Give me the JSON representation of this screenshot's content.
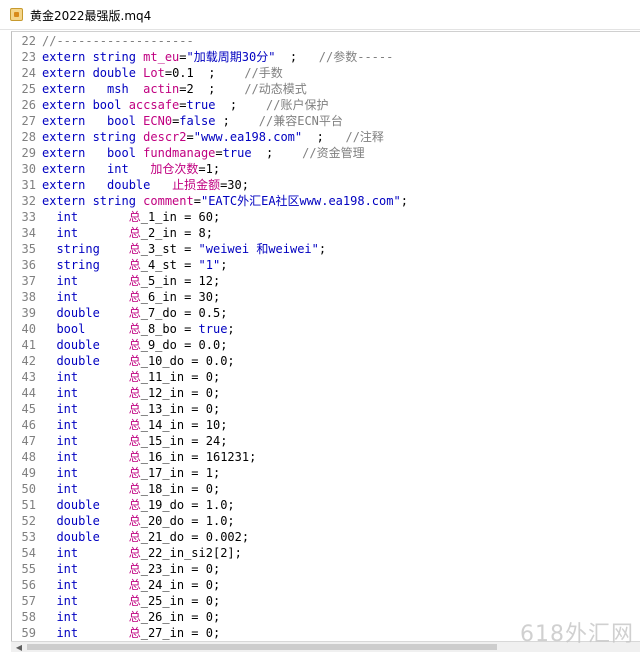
{
  "window": {
    "title": "黄金2022最强版.mq4",
    "icon": "file-mq4-icon"
  },
  "colors": {
    "keyword": "#0000c0",
    "identifier": "#c00080",
    "comment": "#808080",
    "line_number": "#808080"
  },
  "code_lines": [
    {
      "n": "22",
      "tokens": [
        {
          "t": "//-------------------",
          "c": "cmt"
        }
      ]
    },
    {
      "n": "23",
      "tokens": [
        {
          "t": "extern ",
          "c": "kw"
        },
        {
          "t": "string ",
          "c": "tp"
        },
        {
          "t": "mt_eu",
          "c": "id"
        },
        {
          "t": "=",
          "c": "op"
        },
        {
          "t": "\"加载周期30分\"",
          "c": "str"
        },
        {
          "t": "  ;   ",
          "c": "op"
        },
        {
          "t": "//参数-----",
          "c": "cmt"
        }
      ]
    },
    {
      "n": "24",
      "tokens": [
        {
          "t": "extern ",
          "c": "kw"
        },
        {
          "t": "double ",
          "c": "tp"
        },
        {
          "t": "Lot",
          "c": "id"
        },
        {
          "t": "=0.1  ;    ",
          "c": "op"
        },
        {
          "t": "//手数",
          "c": "cmt"
        }
      ]
    },
    {
      "n": "25",
      "tokens": [
        {
          "t": "extern   ",
          "c": "kw"
        },
        {
          "t": "msh  ",
          "c": "tp"
        },
        {
          "t": "actin",
          "c": "id"
        },
        {
          "t": "=2  ;    ",
          "c": "op"
        },
        {
          "t": "//动态模式",
          "c": "cmt"
        }
      ]
    },
    {
      "n": "26",
      "tokens": [
        {
          "t": "extern ",
          "c": "kw"
        },
        {
          "t": "bool ",
          "c": "tp"
        },
        {
          "t": "accsafe",
          "c": "id"
        },
        {
          "t": "=",
          "c": "op"
        },
        {
          "t": "true",
          "c": "kw"
        },
        {
          "t": "  ;    ",
          "c": "op"
        },
        {
          "t": "//账户保护",
          "c": "cmt"
        }
      ]
    },
    {
      "n": "27",
      "tokens": [
        {
          "t": "extern   ",
          "c": "kw"
        },
        {
          "t": "bool ",
          "c": "tp"
        },
        {
          "t": "ECN0",
          "c": "id"
        },
        {
          "t": "=",
          "c": "op"
        },
        {
          "t": "false",
          "c": "kw"
        },
        {
          "t": " ;    ",
          "c": "op"
        },
        {
          "t": "//兼容ECN平台",
          "c": "cmt"
        }
      ]
    },
    {
      "n": "28",
      "tokens": [
        {
          "t": "extern ",
          "c": "kw"
        },
        {
          "t": "string ",
          "c": "tp"
        },
        {
          "t": "descr2",
          "c": "id"
        },
        {
          "t": "=",
          "c": "op"
        },
        {
          "t": "\"www.ea198.com\"",
          "c": "str"
        },
        {
          "t": "  ;   ",
          "c": "op"
        },
        {
          "t": "//注释",
          "c": "cmt"
        }
      ]
    },
    {
      "n": "29",
      "tokens": [
        {
          "t": "extern   ",
          "c": "kw"
        },
        {
          "t": "bool ",
          "c": "tp"
        },
        {
          "t": "fundmanage",
          "c": "id"
        },
        {
          "t": "=",
          "c": "op"
        },
        {
          "t": "true",
          "c": "kw"
        },
        {
          "t": "  ;    ",
          "c": "op"
        },
        {
          "t": "//资金管理",
          "c": "cmt"
        }
      ]
    },
    {
      "n": "30",
      "tokens": [
        {
          "t": "extern   ",
          "c": "kw"
        },
        {
          "t": "int   ",
          "c": "tp"
        },
        {
          "t": "加仓次数",
          "c": "hz"
        },
        {
          "t": "=1;",
          "c": "op"
        }
      ]
    },
    {
      "n": "31",
      "tokens": [
        {
          "t": "extern   ",
          "c": "kw"
        },
        {
          "t": "double   ",
          "c": "tp"
        },
        {
          "t": "止损金额",
          "c": "hz"
        },
        {
          "t": "=30;",
          "c": "op"
        }
      ]
    },
    {
      "n": "32",
      "tokens": [
        {
          "t": "extern ",
          "c": "kw"
        },
        {
          "t": "string ",
          "c": "tp"
        },
        {
          "t": "comment",
          "c": "id"
        },
        {
          "t": "=",
          "c": "op"
        },
        {
          "t": "\"EATC外汇EA社区www.ea198.com\"",
          "c": "str"
        },
        {
          "t": ";",
          "c": "op"
        }
      ]
    },
    {
      "n": "33",
      "tokens": [
        {
          "t": "  int       ",
          "c": "tp"
        },
        {
          "t": "总",
          "c": "hz"
        },
        {
          "t": "_1_in = 60;",
          "c": "op"
        }
      ]
    },
    {
      "n": "34",
      "tokens": [
        {
          "t": "  int       ",
          "c": "tp"
        },
        {
          "t": "总",
          "c": "hz"
        },
        {
          "t": "_2_in = 8;",
          "c": "op"
        }
      ]
    },
    {
      "n": "35",
      "tokens": [
        {
          "t": "  string    ",
          "c": "tp"
        },
        {
          "t": "总",
          "c": "hz"
        },
        {
          "t": "_3_st = ",
          "c": "op"
        },
        {
          "t": "\"weiwei 和weiwei\"",
          "c": "str"
        },
        {
          "t": ";",
          "c": "op"
        }
      ]
    },
    {
      "n": "36",
      "tokens": [
        {
          "t": "  string    ",
          "c": "tp"
        },
        {
          "t": "总",
          "c": "hz"
        },
        {
          "t": "_4_st = ",
          "c": "op"
        },
        {
          "t": "\"1\"",
          "c": "str"
        },
        {
          "t": ";",
          "c": "op"
        }
      ]
    },
    {
      "n": "37",
      "tokens": [
        {
          "t": "  int       ",
          "c": "tp"
        },
        {
          "t": "总",
          "c": "hz"
        },
        {
          "t": "_5_in = 12;",
          "c": "op"
        }
      ]
    },
    {
      "n": "38",
      "tokens": [
        {
          "t": "  int       ",
          "c": "tp"
        },
        {
          "t": "总",
          "c": "hz"
        },
        {
          "t": "_6_in = 30;",
          "c": "op"
        }
      ]
    },
    {
      "n": "39",
      "tokens": [
        {
          "t": "  double    ",
          "c": "tp"
        },
        {
          "t": "总",
          "c": "hz"
        },
        {
          "t": "_7_do = 0.5;",
          "c": "op"
        }
      ]
    },
    {
      "n": "40",
      "tokens": [
        {
          "t": "  bool      ",
          "c": "tp"
        },
        {
          "t": "总",
          "c": "hz"
        },
        {
          "t": "_8_bo = ",
          "c": "op"
        },
        {
          "t": "true",
          "c": "kw"
        },
        {
          "t": ";",
          "c": "op"
        }
      ]
    },
    {
      "n": "41",
      "tokens": [
        {
          "t": "  double    ",
          "c": "tp"
        },
        {
          "t": "总",
          "c": "hz"
        },
        {
          "t": "_9_do = 0.0;",
          "c": "op"
        }
      ]
    },
    {
      "n": "42",
      "tokens": [
        {
          "t": "  double    ",
          "c": "tp"
        },
        {
          "t": "总",
          "c": "hz"
        },
        {
          "t": "_10_do = 0.0;",
          "c": "op"
        }
      ]
    },
    {
      "n": "43",
      "tokens": [
        {
          "t": "  int       ",
          "c": "tp"
        },
        {
          "t": "总",
          "c": "hz"
        },
        {
          "t": "_11_in = 0;",
          "c": "op"
        }
      ]
    },
    {
      "n": "44",
      "tokens": [
        {
          "t": "  int       ",
          "c": "tp"
        },
        {
          "t": "总",
          "c": "hz"
        },
        {
          "t": "_12_in = 0;",
          "c": "op"
        }
      ]
    },
    {
      "n": "45",
      "tokens": [
        {
          "t": "  int       ",
          "c": "tp"
        },
        {
          "t": "总",
          "c": "hz"
        },
        {
          "t": "_13_in = 0;",
          "c": "op"
        }
      ]
    },
    {
      "n": "46",
      "tokens": [
        {
          "t": "  int       ",
          "c": "tp"
        },
        {
          "t": "总",
          "c": "hz"
        },
        {
          "t": "_14_in = 10;",
          "c": "op"
        }
      ]
    },
    {
      "n": "47",
      "tokens": [
        {
          "t": "  int       ",
          "c": "tp"
        },
        {
          "t": "总",
          "c": "hz"
        },
        {
          "t": "_15_in = 24;",
          "c": "op"
        }
      ]
    },
    {
      "n": "48",
      "tokens": [
        {
          "t": "  int       ",
          "c": "tp"
        },
        {
          "t": "总",
          "c": "hz"
        },
        {
          "t": "_16_in = 161231;",
          "c": "op"
        }
      ]
    },
    {
      "n": "49",
      "tokens": [
        {
          "t": "  int       ",
          "c": "tp"
        },
        {
          "t": "总",
          "c": "hz"
        },
        {
          "t": "_17_in = 1;",
          "c": "op"
        }
      ]
    },
    {
      "n": "50",
      "tokens": [
        {
          "t": "  int       ",
          "c": "tp"
        },
        {
          "t": "总",
          "c": "hz"
        },
        {
          "t": "_18_in = 0;",
          "c": "op"
        }
      ]
    },
    {
      "n": "51",
      "tokens": [
        {
          "t": "  double    ",
          "c": "tp"
        },
        {
          "t": "总",
          "c": "hz"
        },
        {
          "t": "_19_do = 1.0;",
          "c": "op"
        }
      ]
    },
    {
      "n": "52",
      "tokens": [
        {
          "t": "  double    ",
          "c": "tp"
        },
        {
          "t": "总",
          "c": "hz"
        },
        {
          "t": "_20_do = 1.0;",
          "c": "op"
        }
      ]
    },
    {
      "n": "53",
      "tokens": [
        {
          "t": "  double    ",
          "c": "tp"
        },
        {
          "t": "总",
          "c": "hz"
        },
        {
          "t": "_21_do = 0.002;",
          "c": "op"
        }
      ]
    },
    {
      "n": "54",
      "tokens": [
        {
          "t": "  int       ",
          "c": "tp"
        },
        {
          "t": "总",
          "c": "hz"
        },
        {
          "t": "_22_in_si2[2];",
          "c": "op"
        }
      ]
    },
    {
      "n": "55",
      "tokens": [
        {
          "t": "  int       ",
          "c": "tp"
        },
        {
          "t": "总",
          "c": "hz"
        },
        {
          "t": "_23_in = 0;",
          "c": "op"
        }
      ]
    },
    {
      "n": "56",
      "tokens": [
        {
          "t": "  int       ",
          "c": "tp"
        },
        {
          "t": "总",
          "c": "hz"
        },
        {
          "t": "_24_in = 0;",
          "c": "op"
        }
      ]
    },
    {
      "n": "57",
      "tokens": [
        {
          "t": "  int       ",
          "c": "tp"
        },
        {
          "t": "总",
          "c": "hz"
        },
        {
          "t": "_25_in = 0;",
          "c": "op"
        }
      ]
    },
    {
      "n": "58",
      "tokens": [
        {
          "t": "  int       ",
          "c": "tp"
        },
        {
          "t": "总",
          "c": "hz"
        },
        {
          "t": "_26_in = 0;",
          "c": "op"
        }
      ]
    },
    {
      "n": "59",
      "tokens": [
        {
          "t": "  int       ",
          "c": "tp"
        },
        {
          "t": "总",
          "c": "hz"
        },
        {
          "t": "_27_in = 0;",
          "c": "op"
        }
      ]
    }
  ],
  "scrollbar": {
    "left_arrow": "◀"
  },
  "watermark": "618外汇网"
}
